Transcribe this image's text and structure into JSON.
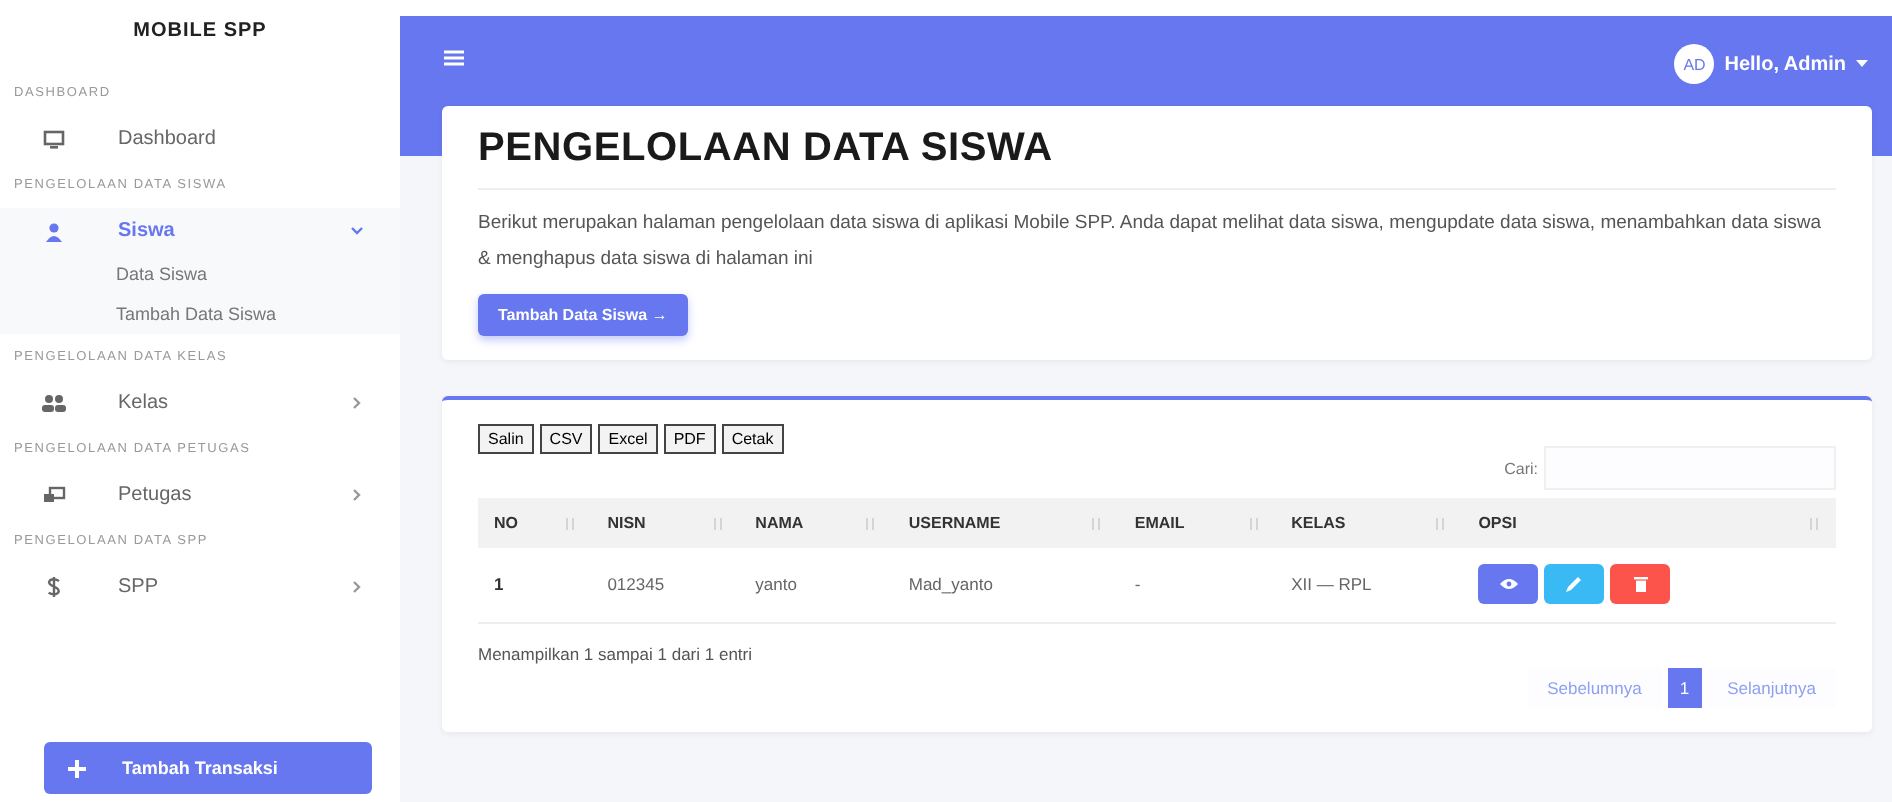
{
  "sidebar": {
    "brand": "MOBILE SPP",
    "sections": [
      {
        "heading": "DASHBOARD",
        "items": [
          {
            "label": "Dashboard",
            "selected": false
          }
        ]
      },
      {
        "heading": "PENGELOLAAN DATA SISWA",
        "items": [
          {
            "label": "Siswa",
            "selected": true,
            "expanded": true,
            "children": [
              {
                "label": "Data Siswa"
              },
              {
                "label": "Tambah Data Siswa"
              }
            ]
          }
        ]
      },
      {
        "heading": "PENGELOLAAN DATA KELAS",
        "items": [
          {
            "label": "Kelas",
            "selected": false,
            "expanded": false
          }
        ]
      },
      {
        "heading": "PENGELOLAAN DATA PETUGAS",
        "items": [
          {
            "label": "Petugas",
            "selected": false,
            "expanded": false
          }
        ]
      },
      {
        "heading": "PENGELOLAAN DATA SPP",
        "items": [
          {
            "label": "SPP",
            "selected": false,
            "expanded": false
          }
        ]
      }
    ],
    "action_button": "Tambah Transaksi"
  },
  "topbar": {
    "avatar": "AD",
    "user": "Hello, Admin"
  },
  "header_card": {
    "title": "PENGELOLAAN DATA SISWA",
    "description": "Berikut merupakan halaman pengelolaan data siswa di aplikasi Mobile SPP. Anda dapat melihat data siswa, mengupdate data siswa, menambahkan data siswa & menghapus data siswa di halaman ini",
    "button": "Tambah Data Siswa →"
  },
  "table_card": {
    "export_buttons": [
      "Salin",
      "CSV",
      "Excel",
      "PDF",
      "Cetak"
    ],
    "search_label": "Cari:",
    "columns": [
      "NO",
      "NISN",
      "NAMA",
      "USERNAME",
      "EMAIL",
      "KELAS",
      "OPSI"
    ],
    "rows": [
      {
        "cells": [
          "1",
          "012345",
          "yanto",
          "Mad_yanto",
          "-",
          "XII — RPL"
        ],
        "actions": [
          {
            "kind": "view"
          },
          {
            "kind": "edit"
          },
          {
            "kind": "delete"
          }
        ]
      }
    ],
    "info": "Menampilkan 1 sampai 1 dari 1 entri",
    "pagination": {
      "previous": "Sebelumnya",
      "pages": [
        {
          "label": "1",
          "selected": true
        }
      ],
      "next": "Selanjutnya"
    }
  }
}
